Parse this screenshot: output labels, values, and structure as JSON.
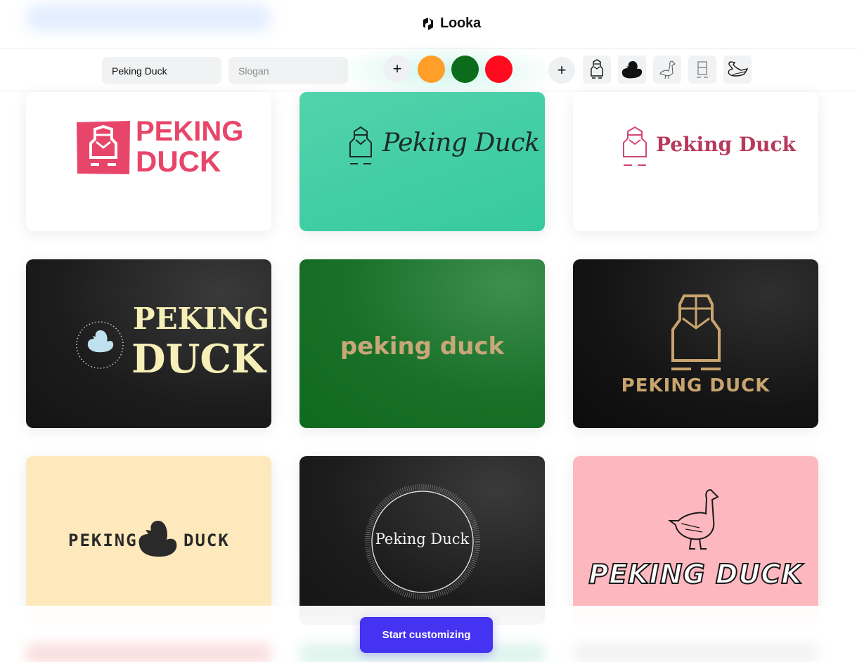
{
  "header": {
    "brand": "Looka",
    "logo_icon": "looka-logo-icon"
  },
  "controls": {
    "name_value": "Peking Duck",
    "slogan_placeholder": "Slogan",
    "colors": [
      "#ff9f2a",
      "#0c6c1c",
      "#ff0a1e"
    ],
    "symbols": [
      "penguin-outline-icon",
      "rubber-duck-icon",
      "goose-sketch-icon",
      "geometric-duck-icon",
      "swan-outline-icon"
    ]
  },
  "logos": [
    {
      "style": "red-badge",
      "line1": "PEKING",
      "line2": "DUCK"
    },
    {
      "style": "mint-script",
      "text": "Peking Duck"
    },
    {
      "style": "pink-serif",
      "text": "Peking Duck"
    },
    {
      "style": "dark-duck-badge",
      "line1": "PEKING",
      "line2": "DUCK"
    },
    {
      "style": "green-gold",
      "text": "peking duck"
    },
    {
      "style": "black-gold",
      "text": "PEKING DUCK"
    },
    {
      "style": "cream-stencil",
      "left": "PEKING",
      "right": "DUCK"
    },
    {
      "style": "dark-circle",
      "text": "Peking Duck"
    },
    {
      "style": "pink-goose",
      "text": "PEKING DUCK"
    }
  ],
  "cta": {
    "label": "Start customizing"
  }
}
